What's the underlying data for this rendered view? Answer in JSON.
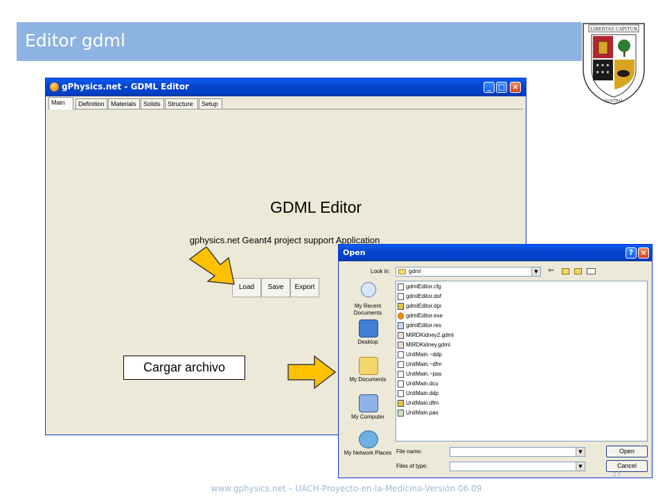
{
  "slide": {
    "title": "Editor gdml",
    "footer": "www.gphysics.net – UACH-Proyecto-en-la-Medicina-Versión 06.09",
    "page_number": "27",
    "crest_text": "LIBERTAS CAPITUR · UNIVERSIDAD AUSTRAL DE CHILE"
  },
  "main_window": {
    "title": "gPhysics.net - GDML Editor",
    "tabs": [
      {
        "label": "Main"
      },
      {
        "label": "Definition"
      },
      {
        "label": "Materials"
      },
      {
        "label": "Solids"
      },
      {
        "label": "Structure"
      },
      {
        "label": "Setup"
      }
    ],
    "heading": "GDML Editor",
    "subtitle": "gphysics.net Geant4 project support Application",
    "buttons": {
      "load": "Load",
      "save": "Save",
      "export": "Export"
    }
  },
  "open_dialog": {
    "title": "Open",
    "look_in_label": "Look in:",
    "look_in_value": "gdml",
    "places": [
      {
        "label": "My Recent Documents"
      },
      {
        "label": "Desktop"
      },
      {
        "label": "My Documents"
      },
      {
        "label": "My Computer"
      },
      {
        "label": "My Network Places"
      }
    ],
    "files": [
      {
        "name": "gdmlEditor.cfg"
      },
      {
        "name": "gdmlEditor.dof"
      },
      {
        "name": "gdmlEditor.dpr"
      },
      {
        "name": "gdmlEditor.exe"
      },
      {
        "name": "gdmlEditor.res"
      },
      {
        "name": "MIRDKidney2.gdml"
      },
      {
        "name": "MIRDKidney.gdml"
      },
      {
        "name": "UnitMain.~ddp"
      },
      {
        "name": "UnitMain.~dfm"
      },
      {
        "name": "UnitMain.~pas"
      },
      {
        "name": "UnitMain.dcu"
      },
      {
        "name": "UnitMain.ddp"
      },
      {
        "name": "UnitMain.dfm"
      },
      {
        "name": "UnitMain.pas"
      }
    ],
    "file_name_label": "File name:",
    "file_name_value": "",
    "file_type_label": "Files of type:",
    "file_type_value": "",
    "open_button": "Open",
    "cancel_button": "Cancel"
  },
  "callout": {
    "text": "Cargar archivo"
  },
  "colors": {
    "title_bar": "#8db3e2",
    "xp_blue": "#0a5ef3",
    "arrow_fill": "#ffc000"
  }
}
